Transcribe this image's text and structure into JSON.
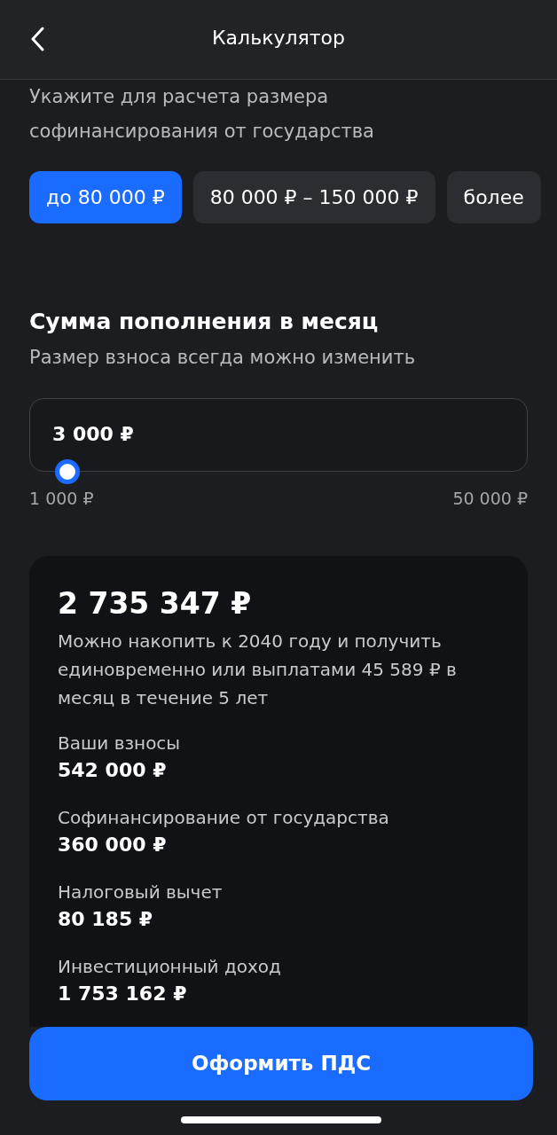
{
  "header": {
    "title": "Калькулятор"
  },
  "income": {
    "hint": "Укажите для расчета размера софинансирования от государства",
    "options": [
      {
        "label": "до 80 000 ₽",
        "selected": true
      },
      {
        "label": "80 000 ₽ – 150 000 ₽",
        "selected": false
      },
      {
        "label": "более",
        "selected": false
      }
    ]
  },
  "contribution": {
    "title": "Сумма пополнения в месяц",
    "subtitle": "Размер взноса всегда можно изменить",
    "value": "3 000 ₽",
    "level": 0.04,
    "min_label": "1 000 ₽",
    "max_label": "50 000 ₽"
  },
  "result": {
    "total": "2 735 347 ₽",
    "description": "Можно накопить к 2040 году и получить единовременно или выплатами 45 589 ₽ в месяц в течение 5 лет",
    "items": [
      {
        "label": "Ваши взносы",
        "value": "542 000 ₽"
      },
      {
        "label": "Софинансирование от государства",
        "value": "360 000 ₽"
      },
      {
        "label": "Налоговый вычет",
        "value": "80 185 ₽"
      },
      {
        "label": "Инвестиционный доход",
        "value": "1 753 162 ₽"
      }
    ]
  },
  "submit_button": "Оформить ПДС"
}
